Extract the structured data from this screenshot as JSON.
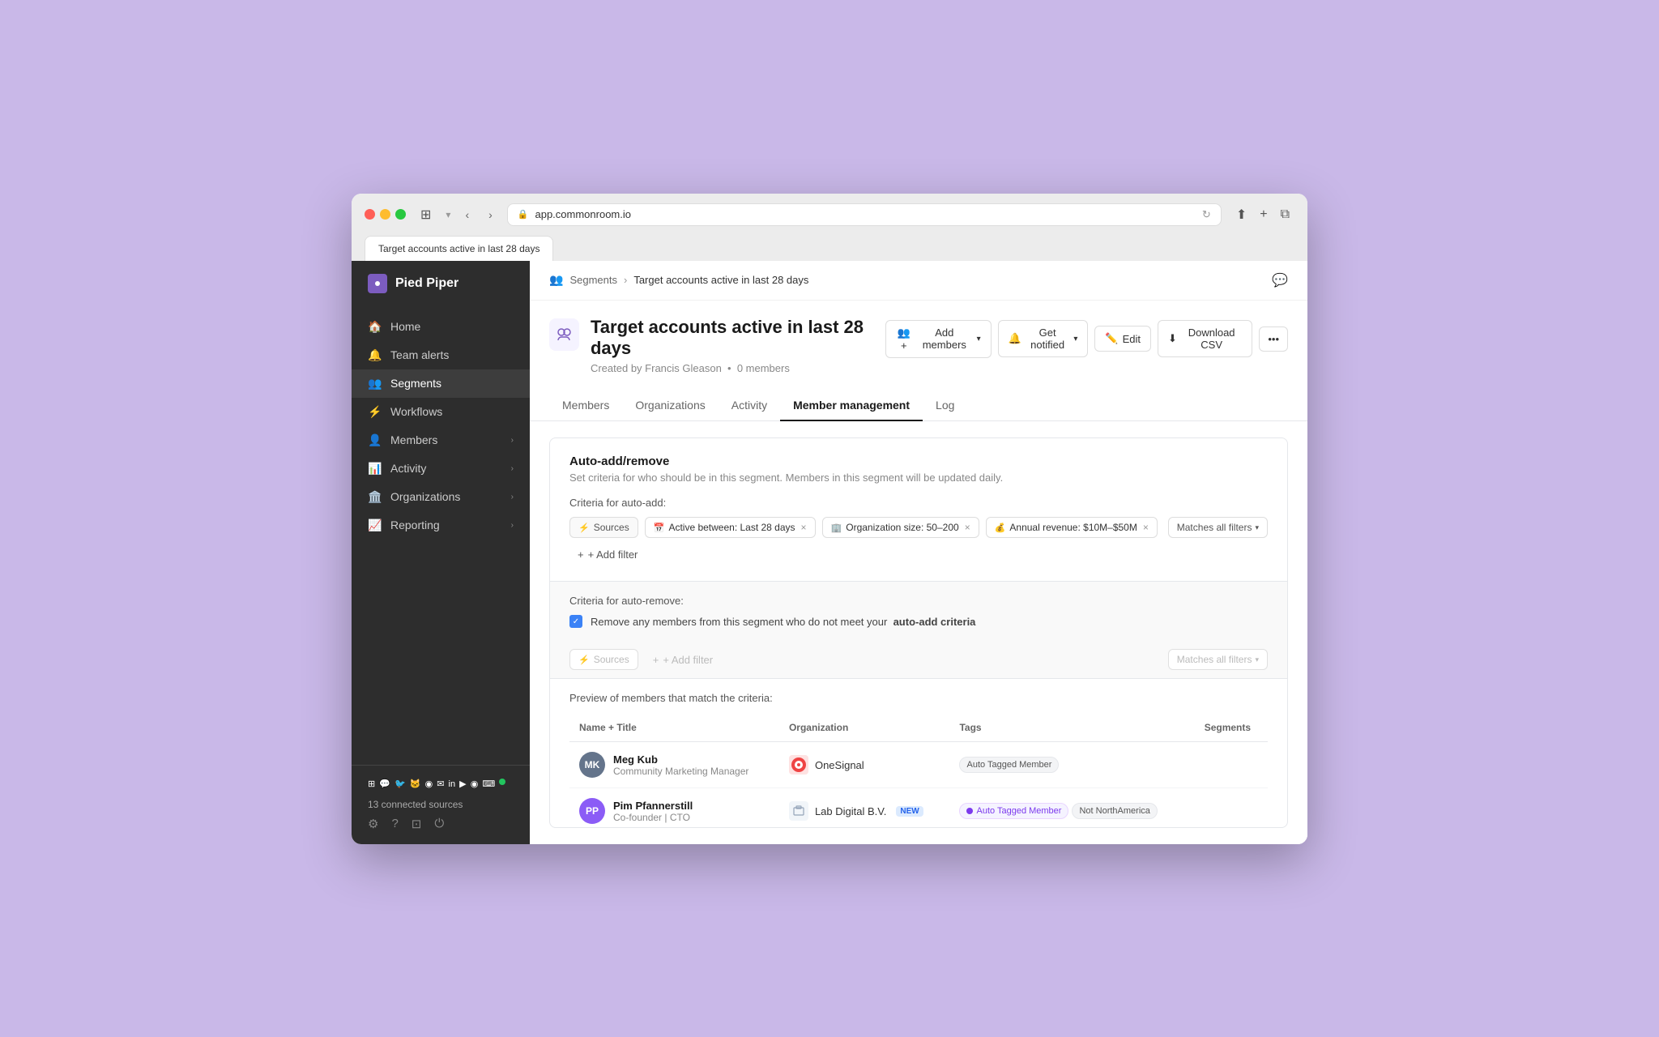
{
  "browser": {
    "url": "app.commonroom.io",
    "tab_label": "Target accounts active in last 28 days"
  },
  "breadcrumb": {
    "parent": "Segments",
    "current": "Target accounts active in last 28 days"
  },
  "page": {
    "title": "Target accounts active in last 28 days",
    "subtitle": "Created by Francis Gleason",
    "members_count": "0 members"
  },
  "header_actions": {
    "add_members": "Add members",
    "get_notified": "Get notified",
    "edit": "Edit",
    "download_csv": "Download CSV"
  },
  "tabs": [
    {
      "label": "Members",
      "active": false
    },
    {
      "label": "Organizations",
      "active": false
    },
    {
      "label": "Activity",
      "active": false
    },
    {
      "label": "Member management",
      "active": true
    },
    {
      "label": "Log",
      "active": false
    }
  ],
  "auto_add": {
    "title": "Auto-add/remove",
    "description": "Set criteria for who should be in this segment. Members in this segment will be updated daily.",
    "criteria_label": "Criteria for auto-add:",
    "filters": [
      {
        "icon": "⚡",
        "label": "Sources"
      },
      {
        "icon": "📅",
        "label": "Active between: Last 28 days"
      },
      {
        "icon": "🏢",
        "label": "Organization size: 50–200"
      },
      {
        "icon": "💰",
        "label": "Annual revenue: $10M–$50M"
      }
    ],
    "matches_label": "Matches all filters",
    "add_filter_label": "+ Add filter"
  },
  "auto_remove": {
    "criteria_label": "Criteria for auto-remove:",
    "checkbox_text": "Remove any members from this segment who do not meet your",
    "bold_text": "auto-add criteria",
    "sources_label": "Sources",
    "add_filter_label": "+ Add filter",
    "matches_label": "Matches all filters"
  },
  "preview": {
    "title": "Preview of members that match the criteria:",
    "columns": [
      "Name + Title",
      "Organization",
      "Tags",
      "Segments"
    ],
    "rows": [
      {
        "name": "Meg Kub",
        "title": "Community Marketing Manager",
        "avatar_initials": "MK",
        "avatar_color": "#64748b",
        "org": "OneSignal",
        "org_color": "#ef4444",
        "org_icon": "🔴",
        "tags": [
          "Auto Tagged Member"
        ],
        "segments": []
      },
      {
        "name": "Pim Pfannerstill",
        "title": "Co-founder | CTO",
        "avatar_initials": "PP",
        "avatar_color": "#8b5cf6",
        "avatar_type": "photo",
        "org": "Lab Digital B.V.",
        "org_new": true,
        "org_icon": "🏢",
        "org_color": "#94a3b8",
        "tags": [
          "Auto Tagged Member",
          "Not NorthAmerica"
        ],
        "segments": []
      }
    ]
  },
  "sidebar": {
    "brand": "Pied Piper",
    "nav_items": [
      {
        "label": "Home",
        "icon": "🏠",
        "has_arrow": false
      },
      {
        "label": "Team alerts",
        "icon": "🔔",
        "has_arrow": false
      },
      {
        "label": "Segments",
        "icon": "👥",
        "has_arrow": false
      },
      {
        "label": "Workflows",
        "icon": "⚡",
        "has_arrow": false
      },
      {
        "label": "Members",
        "icon": "👤",
        "has_arrow": true
      },
      {
        "label": "Activity",
        "icon": "📊",
        "has_arrow": true
      },
      {
        "label": "Organizations",
        "icon": "🏛️",
        "has_arrow": true
      },
      {
        "label": "Reporting",
        "icon": "📈",
        "has_arrow": true
      }
    ],
    "connected_sources_label": "13 connected sources",
    "footer_buttons": [
      "⚙️",
      "?",
      "⊡",
      "⏻"
    ]
  }
}
